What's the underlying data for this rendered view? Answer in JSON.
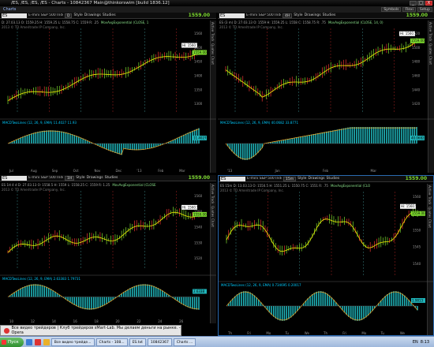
{
  "window": {
    "title": "/ES, /ES, /ES, /ES - Charts - 10842367 Main@thinkorswim [build 1836.12]",
    "buttons": [
      "_",
      "□",
      "X"
    ]
  },
  "charts_tab": "Charts",
  "top_tools": [
    "Symbols",
    "Flexi",
    "Setup"
  ],
  "panels": [
    {
      "symbol": "ES",
      "desc": "E-mini S&P 500 Index Futur",
      "tf": "D",
      "style": "Style",
      "drawings": "Drawings",
      "studies": "Studies",
      "price": "1559.00",
      "info": "D: 27.03.13  O: 1559.25  H: 1559.25  L: 1558.75  C: 1559  R: .25",
      "study": "MovAvgExponential (CLOSE, 1",
      "copyright": "2013 © TD Ameritrade IP Company, Inc.",
      "hilabel": "Hi: 1560.5",
      "yticks": [
        "1560",
        "1500",
        "1450",
        "1400",
        "1350",
        "1300"
      ],
      "xticks": [
        "Jul",
        "Aug",
        "Sep",
        "Oct",
        "Nov",
        "Dec",
        "'13",
        "Feb",
        "Mar"
      ],
      "macd": "MACDTwoLines (12, 26, 9, EMA)  11.4027  11.93",
      "macdval": "11.4027",
      "tabs": [
        "Active",
        "Track",
        "Quotes",
        "Chart"
      ]
    },
    {
      "symbol": "ES",
      "desc": "E-mini S&P 500 Index Futur",
      "tf": "4H",
      "style": "Style",
      "drawings": "Drawings",
      "studies": "Studies",
      "price": "1559.00",
      "info": "ES (3 m)  D: 27.03.13  O: 1559  H: 1559.25  L: 1558  C: 1558.75  R: .75",
      "study": "MovAvgExponential (CLOSE, 14, 0)",
      "copyright": "2013 © TD Ameritrade IP Company, Inc.",
      "hilabel": "Hi: 1560.5",
      "yticks": [
        "1520",
        "1500",
        "1480",
        "1460",
        "1440",
        "1420"
      ],
      "xticks": [
        "'13",
        "Jan",
        "Feb",
        "Mar"
      ],
      "macd": "MACDTwoLines (12, 26, 9, EMA)  40.0682  33.8771",
      "macdval": "40.0682",
      "tabs": [
        "Active",
        "Track",
        "Quotes",
        "Chart"
      ]
    },
    {
      "symbol": "ES",
      "desc": "E-mini S&P 500 Index Futur",
      "tf": "1H",
      "style": "Style",
      "drawings": "Drawings",
      "studies": "Studies",
      "price": "1559.00",
      "info": "ES 1H 4 d  D: 27.03.13  O: 1558.5  H: 1559  L: 1558.25  C: 1559  R: 1.25",
      "study": "MovAvgExponential (CLOSE",
      "copyright": "2013 © TD Ameritrade IP Company, Inc.",
      "hilabel": "Hi: 1560.5",
      "yticks": [
        "1560",
        "1550",
        "1540",
        "1530",
        "1520"
      ],
      "xticks": [
        "10",
        "12",
        "14",
        "16",
        "18",
        "20",
        "22",
        "24",
        "26"
      ],
      "macd": "MACDTwoLines (12, 26, 9, EMA)  2.63383  1.79731",
      "macdval": "2.6338",
      "tabs": [
        "Active",
        "Track",
        "Quotes",
        "Chart"
      ]
    },
    {
      "symbol": "ES",
      "desc": "E-mini S&P 500 Index Futur",
      "tf": "15m",
      "style": "Style",
      "drawings": "Drawings",
      "studies": "Studies",
      "price": "1559.00",
      "info": "ES 15m  D: 13.03.13  O: 1550.5  H: 1551.25  L: 1550.75  C: 1551  R: .75",
      "study": "MovAvgExponential (CLO",
      "copyright": "2013 © TD Ameritrade IP Company, Inc.",
      "hilabel": "Hi: 1560.5",
      "yticks": [
        "1560",
        "1555",
        "1550",
        "1545",
        "1540"
      ],
      "xticks": [
        "Th",
        "Fri",
        "Mo",
        "Tu",
        "We",
        "Th",
        "Fri",
        "Mo",
        "Tu",
        "We"
      ],
      "macd": "MACDTwoLines (12, 26, 9, EMA)  0.734695  0.20017",
      "macdval": "1.9813",
      "tabs": [
        "Active",
        "Track",
        "Quotes",
        "Chart"
      ]
    }
  ],
  "notification": "Все видео трейдеров | Клуб трейдеров sMart-Lab. Мы делаем деньги на рынке. - Opera",
  "taskbar": {
    "start": "Пуск",
    "items": [
      "Все видео трейде...",
      "Charts - 108...",
      "ES.txt",
      "10842367",
      "Charts ..."
    ],
    "lang": "EN",
    "clock": "8:13"
  },
  "colors": {
    "up": "#7ddb2f",
    "hist": "#1fb3b8",
    "ema": "#f0f000",
    "accent": "#2a6ab0"
  }
}
